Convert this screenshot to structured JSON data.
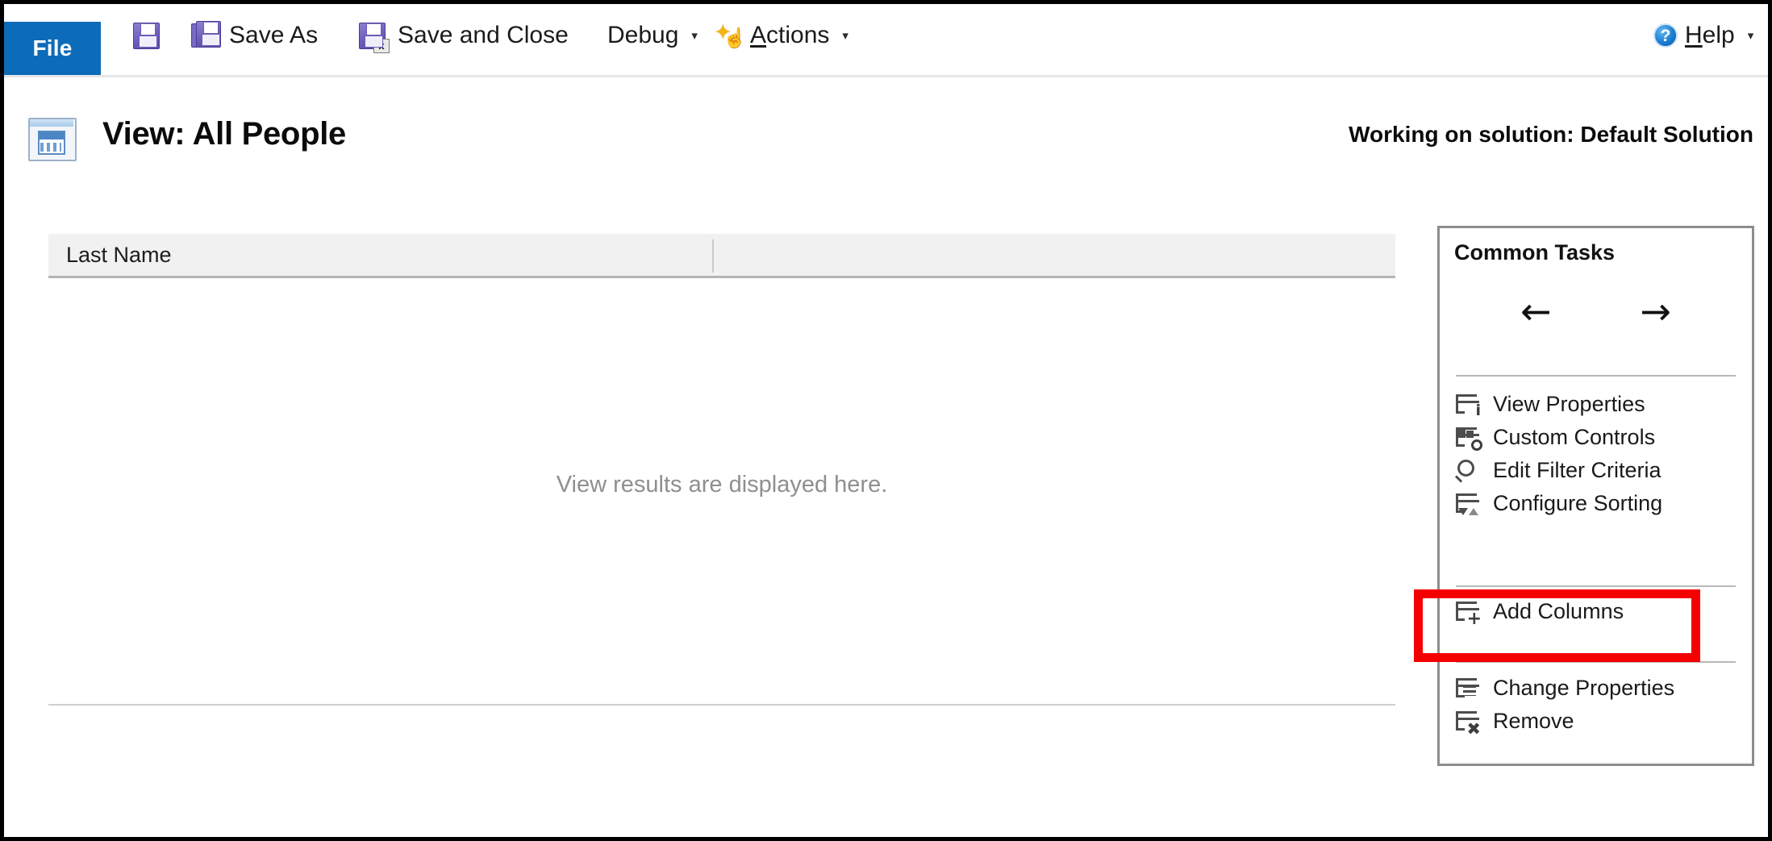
{
  "ribbon": {
    "file_tab": "File",
    "items": [
      {
        "label": "",
        "icon": "save-icon",
        "has_caret": false
      },
      {
        "label": "Save As",
        "icon": "save-as-icon",
        "has_caret": false
      },
      {
        "label": "Save and Close",
        "icon": "save-and-close-icon",
        "has_caret": false
      },
      {
        "label": "Debug",
        "icon": "",
        "has_caret": true
      },
      {
        "label": "Actions",
        "icon": "actions-icon",
        "has_caret": true
      }
    ],
    "save_label": "",
    "save_as_label": "Save As",
    "save_and_close_label": "Save and Close",
    "debug_label_pre": "Debu",
    "debug_label_acc": "g",
    "actions_label_acc": "A",
    "actions_label_post": "ctions",
    "help_label_acc": "H",
    "help_label_post": "elp",
    "caret": "▾",
    "help_icon_glyph": "?"
  },
  "header": {
    "title": "View: All People",
    "solution": "Working on solution: Default Solution",
    "icon": "view-form-icon"
  },
  "grid": {
    "columns": [
      "Last Name"
    ],
    "empty_text": "View results are displayed here."
  },
  "common_tasks": {
    "title": "Common Tasks",
    "nav": {
      "back": "←",
      "forward": "→"
    },
    "groups": [
      {
        "items": [
          {
            "label": "View Properties",
            "icon": "view-properties-icon"
          },
          {
            "label": "Custom Controls",
            "icon": "custom-controls-icon"
          },
          {
            "label": "Edit Filter Criteria",
            "icon": "edit-filter-criteria-icon"
          },
          {
            "label": "Configure Sorting",
            "icon": "configure-sorting-icon"
          }
        ]
      },
      {
        "items": [
          {
            "label": "Add Columns",
            "icon": "add-columns-icon",
            "highlighted": true
          }
        ]
      },
      {
        "items": [
          {
            "label": "Change Properties",
            "icon": "change-properties-icon"
          },
          {
            "label": "Remove",
            "icon": "remove-icon"
          }
        ]
      }
    ]
  },
  "colors": {
    "file_tab_blue": "#0d6cb9",
    "annotation_red": "#f40000",
    "grid_header_gray": "#f1f1f1",
    "panel_border_gray": "#8d8d8d",
    "muted_text": "#8f8f8f"
  }
}
